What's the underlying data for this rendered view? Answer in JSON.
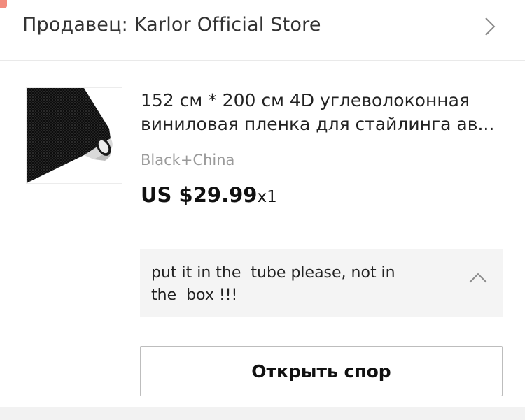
{
  "seller": {
    "title": "Продавец: Karlor Official Store",
    "chevron_icon": "chevron-right-icon"
  },
  "product": {
    "image_icon": "carbon-fiber-vinyl-roll",
    "title": "152 см * 200 см 4D углеволоконная виниловая пленка для стайлинга ав...",
    "variant": "Black+China",
    "price": "US $29.99",
    "quantity": "x1"
  },
  "note": {
    "text": "put it in the  tube please, not in\nthe  box !!!",
    "toggle_icon": "chevron-up-icon"
  },
  "actions": {
    "open_dispute_label": "Открыть спор"
  },
  "colors": {
    "background": "#ffffff",
    "note_background": "#f4f4f4",
    "badge": "#f28b7d",
    "muted_text": "#9a9a9a"
  }
}
